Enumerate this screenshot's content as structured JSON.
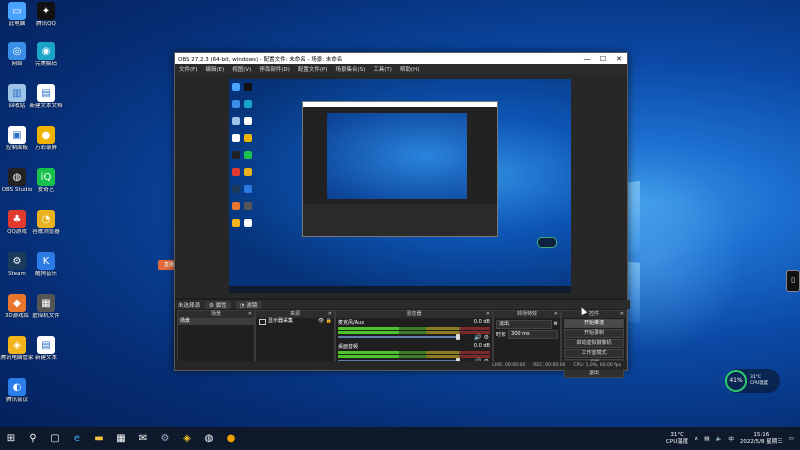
{
  "desktop": {
    "icons": [
      {
        "label": "此电脑",
        "icon": "pc-icon",
        "color": "#4aa3ff",
        "glyph": "▭"
      },
      {
        "label": "腾讯QQ",
        "icon": "qq-icon",
        "color": "#111111",
        "glyph": "✦"
      },
      {
        "label": "网络",
        "icon": "network-icon",
        "color": "#3a8ee6",
        "glyph": "◎"
      },
      {
        "label": "完美解码",
        "icon": "media-player-icon",
        "color": "#1aa5c8",
        "glyph": "◉"
      },
      {
        "label": "回收站",
        "icon": "recycle-bin-icon",
        "color": "#9fc3e6",
        "glyph": "▥"
      },
      {
        "label": "新建文本文档",
        "icon": "text-file-icon",
        "color": "#ffffff",
        "glyph": "▤"
      },
      {
        "label": "控制面板",
        "icon": "control-panel-icon",
        "color": "#ffffff",
        "glyph": "▣"
      },
      {
        "label": "万彩录屏",
        "icon": "screen-recorder-icon",
        "color": "#f0b400",
        "glyph": "●"
      },
      {
        "label": "OBS Studio",
        "icon": "obs-icon",
        "color": "#222222",
        "glyph": "◍"
      },
      {
        "label": "爱奇艺",
        "icon": "iqiyi-icon",
        "color": "#19c24c",
        "glyph": "iQ"
      },
      {
        "label": "QQ游戏",
        "icon": "qq-game-icon",
        "color": "#e23b2e",
        "glyph": "♣"
      },
      {
        "label": "谷歌浏览器",
        "icon": "chrome-icon",
        "color": "#e9b21e",
        "glyph": "◔"
      },
      {
        "label": "Steam",
        "icon": "steam-icon",
        "color": "#1a3a5c",
        "glyph": "⚙"
      },
      {
        "label": "酷狗音乐",
        "icon": "kugou-icon",
        "color": "#2c7be5",
        "glyph": "K"
      },
      {
        "label": "3D游戏库",
        "icon": "game-library-icon",
        "color": "#e8772e",
        "glyph": "◆"
      },
      {
        "label": "虚拟机文件",
        "icon": "vm-file-icon",
        "color": "#555555",
        "glyph": "▦"
      },
      {
        "label": "腾讯电脑管家",
        "icon": "pc-manager-icon",
        "color": "#f3b51b",
        "glyph": "◈"
      },
      {
        "label": "新建文本",
        "icon": "new-doc-icon",
        "color": "#ffffff",
        "glyph": "▤"
      },
      {
        "label": "腾讯会议",
        "icon": "meeting-icon",
        "color": "#2b7de9",
        "glyph": "◐"
      }
    ],
    "orange_tag": "直播",
    "phone_widget": "▯"
  },
  "obs": {
    "title": "OBS 27.2.3 (64-bit, windows) - 配置文件: 未命名 - 场景: 未命名",
    "menu": [
      "文件(F)",
      "编辑(E)",
      "视图(V)",
      "停靠部件(D)",
      "配置文件(P)",
      "场景集合(S)",
      "工具(T)",
      "帮助(H)"
    ],
    "window_controls": {
      "min": "—",
      "max": "☐",
      "close": "✕"
    },
    "scene_tabs": [
      "未选择源",
      "属性",
      "滤镜"
    ],
    "docks": {
      "scenes_title": "场景",
      "sources_title": "来源",
      "mixer_title": "混音器",
      "transitions_title": "转场特效",
      "controls_title": "控件"
    },
    "scenes": [
      "场景"
    ],
    "sources": [
      {
        "name": "显示器采集"
      }
    ],
    "mixer": [
      {
        "name": "麦克风/Aux",
        "level": "0.0 dB"
      },
      {
        "name": "桌面音频",
        "level": "0.0 dB"
      }
    ],
    "transition": {
      "type": "淡出",
      "duration_label": "时长",
      "duration": "300 ms"
    },
    "controls": [
      "开始推流",
      "开始录制",
      "启动虚拟摄像机",
      "工作室模式",
      "设置",
      "退出"
    ],
    "status": {
      "live": "LIVE: 00:00:00",
      "rec": "REC: 00:00:00",
      "cpu": "CPU: 1.0%, 60.00 fps"
    },
    "dock_close": "✕",
    "foot_buttons": "+ − ∧ ∨",
    "sources_foot": "+ − ⚙ ∧ ∨"
  },
  "widgets": {
    "cpu_percent": "41%",
    "temp": "31°C",
    "cpu_label": "CPU温度"
  },
  "taskbar": {
    "weather_temp": "31°C",
    "weather_label": "CPU温度",
    "time": "15:16",
    "date": "2022/5/8 星期三",
    "apps": [
      "start-icon",
      "search-icon",
      "task-view-icon",
      "edge-icon",
      "file-explorer-icon",
      "store-icon",
      "mail-icon",
      "steam-taskbar-icon",
      "qq-taskbar-icon",
      "obs-taskbar-icon",
      "recorder-taskbar-icon"
    ]
  }
}
